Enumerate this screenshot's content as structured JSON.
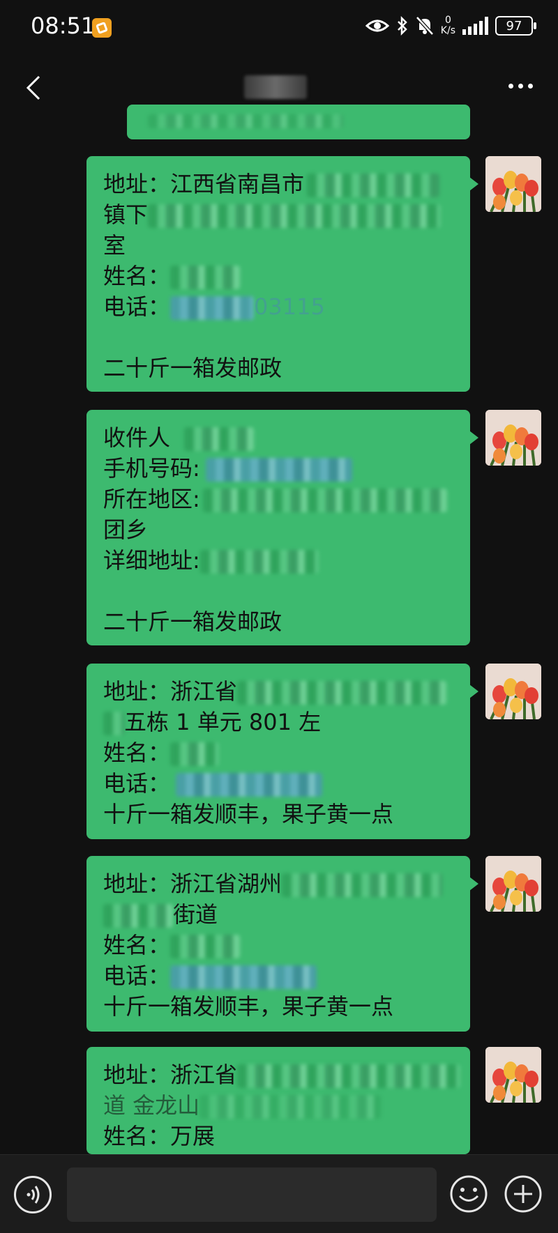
{
  "status_bar": {
    "time": "08:51",
    "net_speed_value": "0",
    "net_speed_unit": "K/s",
    "battery": "97",
    "icons": [
      "app-badge-icon",
      "eye-icon",
      "bluetooth-icon",
      "mute-icon",
      "signal-icon",
      "battery-icon"
    ]
  },
  "header": {
    "title": "",
    "back_icon": "chevron-left-icon",
    "more_icon": "more-dots-icon"
  },
  "messages": [
    {
      "lines": [
        {
          "text": "地址：江西省南昌市",
          "redacted": true
        },
        {
          "text": "镇下",
          "redacted": true
        },
        {
          "text": "室",
          "redacted": false
        },
        {
          "text": "姓名：",
          "redacted": true
        },
        {
          "text": "电话：",
          "redacted": true,
          "tail": "03115"
        },
        {
          "text": "",
          "redacted": false
        },
        {
          "text": "二十斤一箱发邮政",
          "redacted": false
        }
      ]
    },
    {
      "lines": [
        {
          "text": "收件人",
          "redacted": true
        },
        {
          "text": "手机号码:",
          "redacted": true
        },
        {
          "text": "所在地区:",
          "redacted": true
        },
        {
          "text": "团乡",
          "redacted": false
        },
        {
          "text": "详细地址:",
          "redacted": true
        },
        {
          "text": "",
          "redacted": false
        },
        {
          "text": "二十斤一箱发邮政",
          "redacted": false
        }
      ]
    },
    {
      "lines": [
        {
          "text": "地址：浙江省",
          "redacted": true
        },
        {
          "text": "五栋 1 单元 801 左",
          "redacted": true
        },
        {
          "text": "姓名：",
          "redacted": true
        },
        {
          "text": "电话：",
          "redacted": true
        },
        {
          "text": "十斤一箱发顺丰，果子黄一点",
          "redacted": false
        }
      ]
    },
    {
      "lines": [
        {
          "text": "地址：浙江省湖州",
          "redacted": true
        },
        {
          "text": "街道",
          "redacted": true
        },
        {
          "text": "姓名：",
          "redacted": true
        },
        {
          "text": "电话：",
          "redacted": true
        },
        {
          "text": "十斤一箱发顺丰，果子黄一点",
          "redacted": false
        }
      ]
    },
    {
      "lines": [
        {
          "text": "地址：浙江省",
          "redacted": true
        },
        {
          "text": "道 金龙山",
          "redacted": true
        },
        {
          "text": "姓名：万展",
          "redacted": false
        }
      ]
    }
  ],
  "input": {
    "placeholder": "",
    "voice_icon": "voice-icon",
    "emoji_icon": "emoji-icon",
    "plus_icon": "plus-icon"
  }
}
